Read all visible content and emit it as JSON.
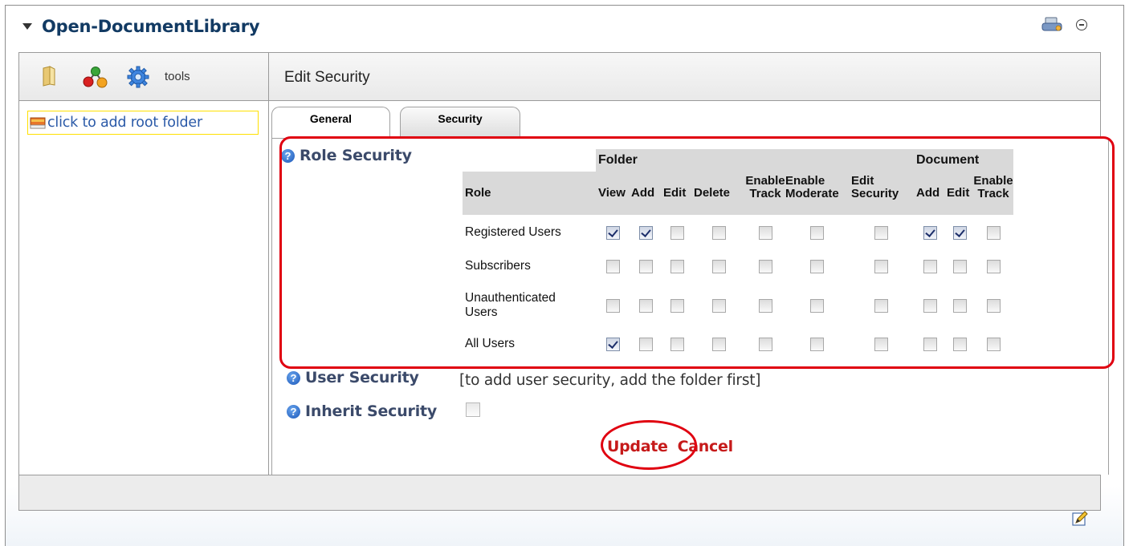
{
  "module": {
    "title": "Open-DocumentLibrary",
    "icons": [
      "collapse-triangle-icon",
      "print-icon",
      "minimize-icon",
      "edit-pencil-icon"
    ]
  },
  "toolbar": {
    "tools_label": "tools",
    "icons": [
      "folder-icon",
      "org-chart-icon",
      "gear-icon"
    ]
  },
  "edit_panel": {
    "title": "Edit Security"
  },
  "tree": {
    "root_folder_label": "click to add root folder"
  },
  "tabs": [
    {
      "label": "General",
      "active": false
    },
    {
      "label": "Security",
      "active": true
    }
  ],
  "role_security": {
    "label": "Role Security",
    "group_headers": {
      "folder": "Folder",
      "document": "Document"
    },
    "columns": [
      {
        "label": "Role",
        "group": ""
      },
      {
        "label": "View",
        "group": "Folder"
      },
      {
        "label": "Add",
        "group": "Folder"
      },
      {
        "label": "Edit",
        "group": "Folder"
      },
      {
        "label": "Delete",
        "group": "Folder"
      },
      {
        "label": "Enable Track",
        "group": "Folder"
      },
      {
        "label": "Enable Moderate",
        "group": "Folder"
      },
      {
        "label": "Edit Security",
        "group": "Folder"
      },
      {
        "label": "Add",
        "group": "Document"
      },
      {
        "label": "Edit",
        "group": "Document"
      },
      {
        "label": "Enable Track",
        "group": "Document"
      }
    ],
    "column_lines": {
      "enable_track_1": "Enable",
      "enable_track_2": "Track",
      "enable_moderate_1": "Enable",
      "enable_moderate_2": "Moderate",
      "edit_security_1": "Edit",
      "edit_security_2": "Security",
      "doc_enable_track_1": "Enable",
      "doc_enable_track_2": "Track"
    },
    "rows": [
      {
        "role": "Registered Users",
        "checks": [
          true,
          true,
          false,
          false,
          false,
          false,
          false,
          true,
          true,
          false
        ]
      },
      {
        "role": "Subscribers",
        "checks": [
          false,
          false,
          false,
          false,
          false,
          false,
          false,
          false,
          false,
          false
        ]
      },
      {
        "role": "Unauthenticated Users",
        "checks": [
          false,
          false,
          false,
          false,
          false,
          false,
          false,
          false,
          false,
          false
        ]
      },
      {
        "role": "All Users",
        "checks": [
          true,
          false,
          false,
          false,
          false,
          false,
          false,
          false,
          false,
          false
        ]
      }
    ]
  },
  "user_security": {
    "label": "User Security",
    "note": "[to add user security, add the folder first]"
  },
  "inherit_security": {
    "label": "Inherit Security",
    "checked": false
  },
  "actions": {
    "update": "Update",
    "cancel": "Cancel"
  },
  "colors": {
    "title": "#123a63",
    "link": "#2b5aa8",
    "action": "#c61a1a",
    "highlight": "#e00010",
    "help": "#1a56b8"
  }
}
